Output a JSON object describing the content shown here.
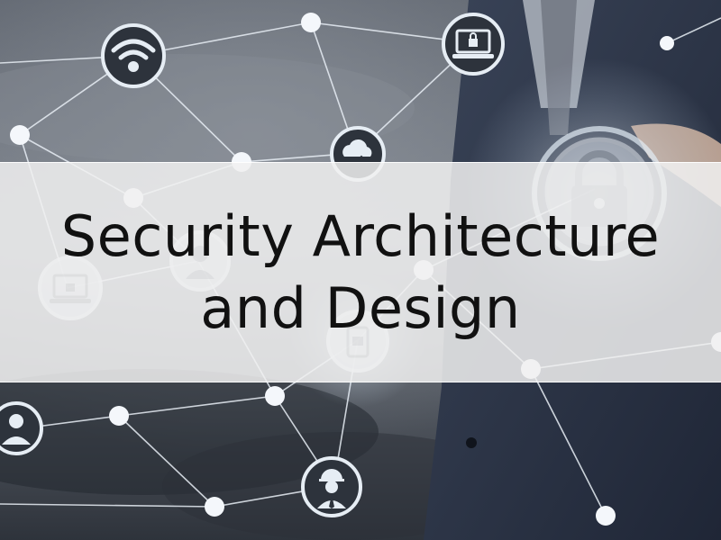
{
  "title": {
    "line1": "Security Architecture",
    "line2": "and Design"
  },
  "colors": {
    "sky_top": "#4a4f58",
    "sky_bottom": "#2f343c",
    "suit": "#2a3244",
    "network_line": "#e8eef5",
    "node_fill": "#f4f7fb",
    "icon_ring": "#dfe6ee",
    "banner_text": "#111111"
  },
  "icons": [
    "wifi-icon",
    "laptop-lock-icon",
    "cloud-sync-icon",
    "padlock-icon",
    "user-icon",
    "worker-icon",
    "businessman-icon"
  ]
}
